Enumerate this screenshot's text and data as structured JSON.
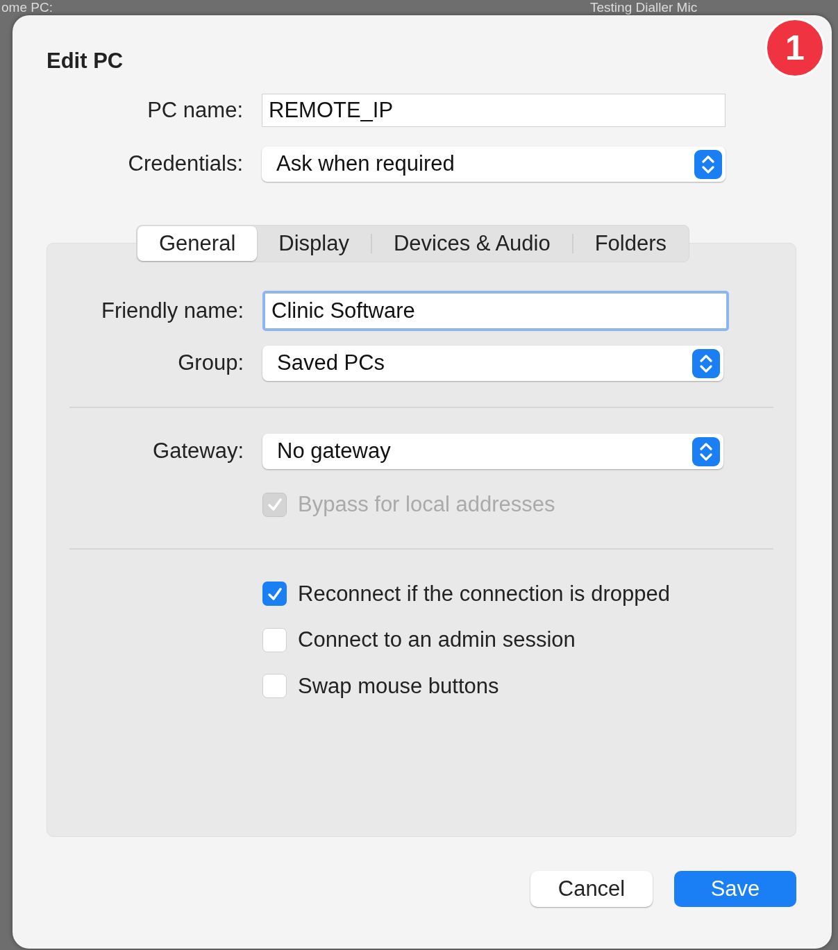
{
  "background": {
    "texts": [
      "ome PC:",
      "Testing Dialler Mic"
    ]
  },
  "badge": "1",
  "dialog": {
    "title": "Edit PC",
    "fields": [
      {
        "kind": "text",
        "label": "PC name:",
        "value": "REMOTE_IP"
      },
      {
        "kind": "popup",
        "label": "Credentials:",
        "value": "Ask when required"
      }
    ],
    "tabs": [
      {
        "label": "General",
        "selected": true
      },
      {
        "label": "Display",
        "selected": false
      },
      {
        "label": "Devices & Audio",
        "selected": false
      },
      {
        "label": "Folders",
        "selected": false
      }
    ],
    "panel_rows": [
      {
        "kind": "text",
        "label": "Friendly name:",
        "value": "Clinic Software",
        "focused": true
      },
      {
        "kind": "popup",
        "label": "Group:",
        "value": "Saved PCs"
      },
      {
        "kind": "divider"
      },
      {
        "kind": "popup",
        "label": "Gateway:",
        "value": "No gateway"
      },
      {
        "kind": "checkbox",
        "label": "Bypass for local addresses",
        "checked": true,
        "disabled": true
      },
      {
        "kind": "divider"
      },
      {
        "kind": "checkbox",
        "label": "Reconnect if the connection is dropped",
        "checked": true,
        "disabled": false
      },
      {
        "kind": "checkbox",
        "label": "Connect to an admin session",
        "checked": false,
        "disabled": false
      },
      {
        "kind": "checkbox",
        "label": "Swap mouse buttons",
        "checked": false,
        "disabled": false
      }
    ],
    "buttons": [
      {
        "label": "Cancel",
        "kind": "default"
      },
      {
        "label": "Save",
        "kind": "primary"
      }
    ]
  }
}
